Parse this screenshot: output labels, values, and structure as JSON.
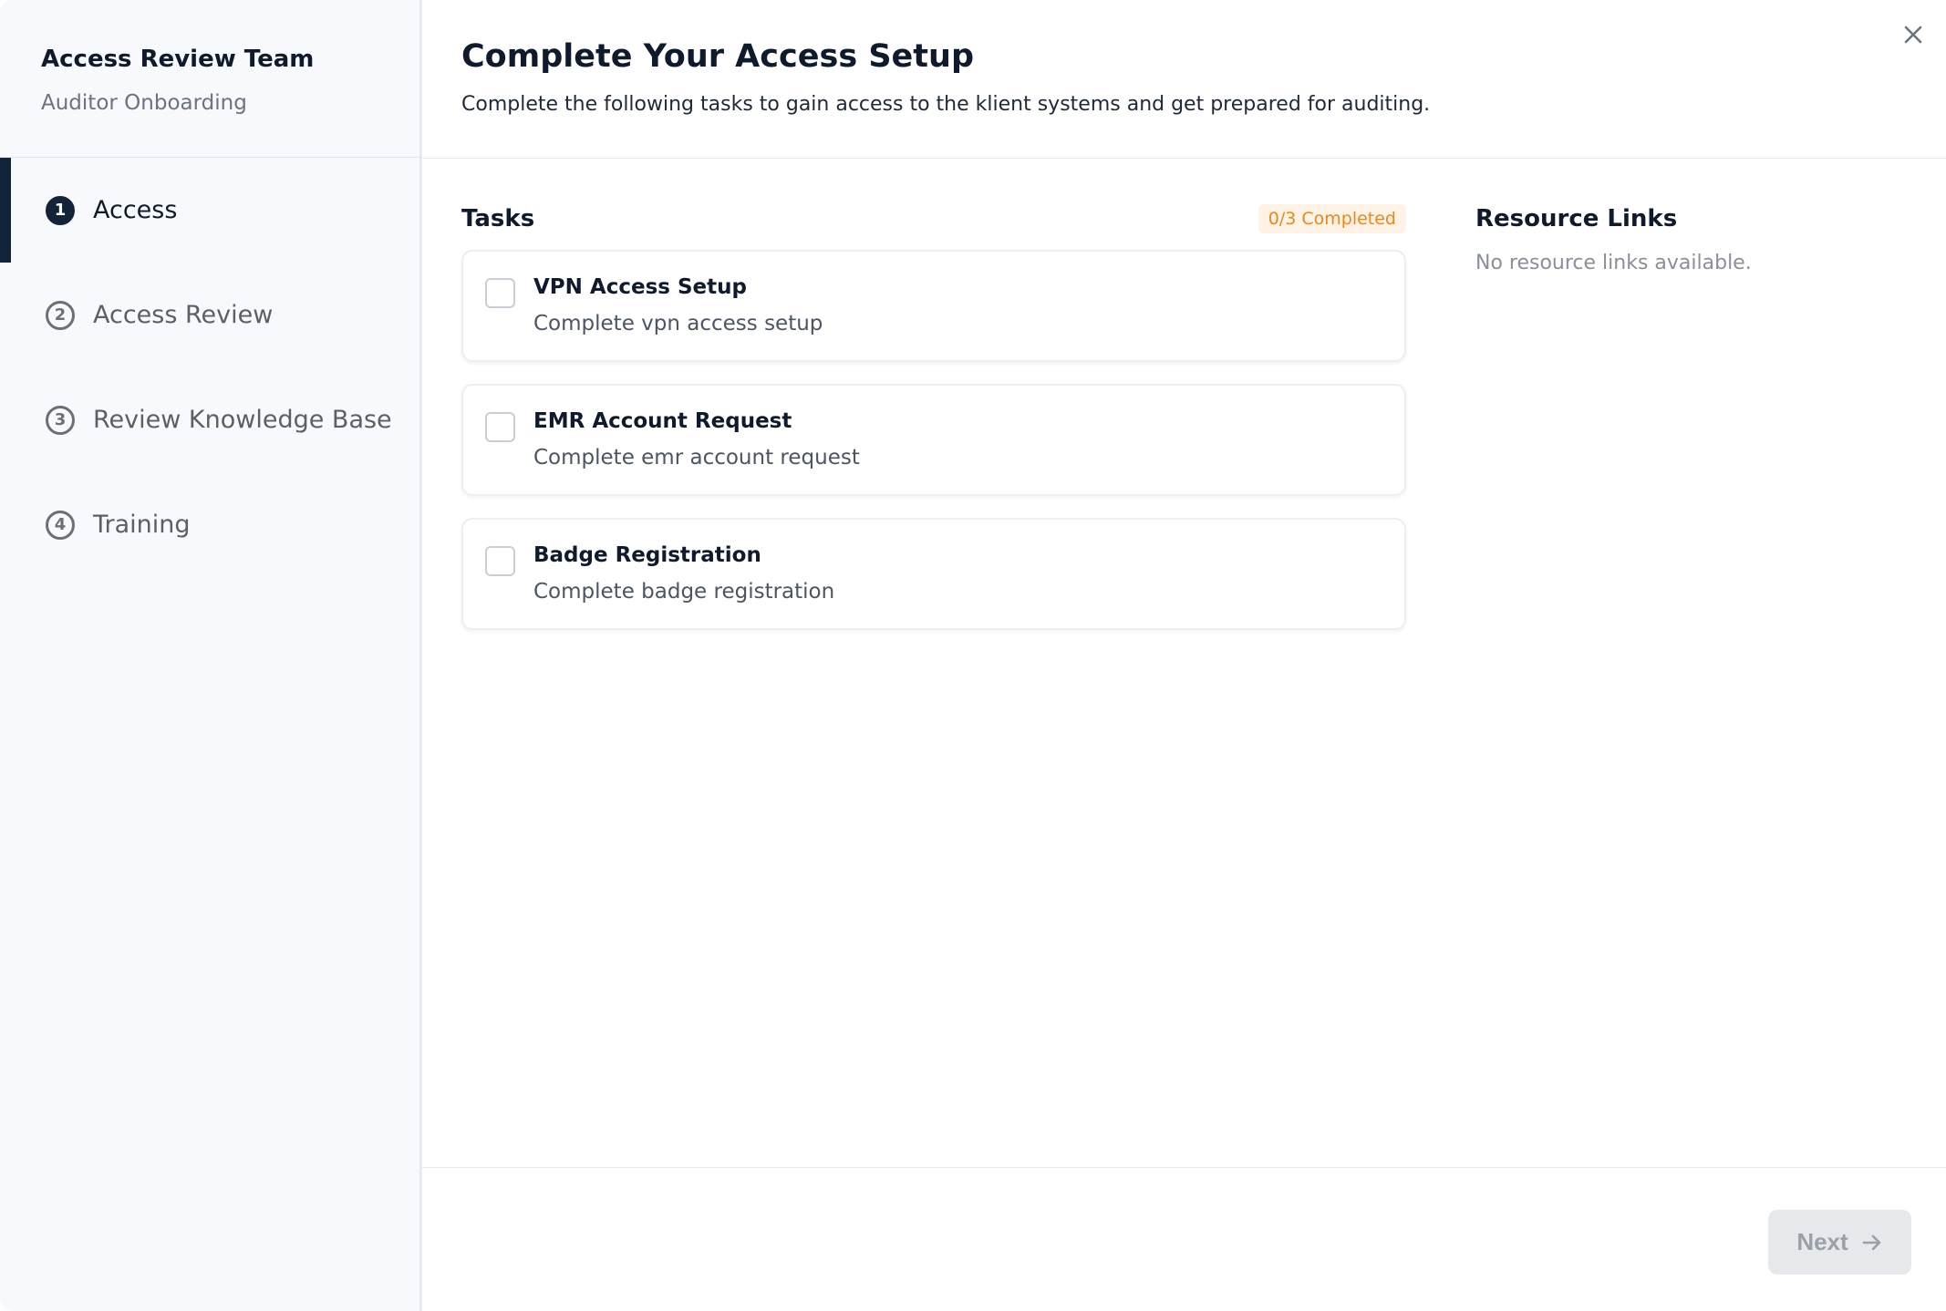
{
  "sidebar": {
    "team_name": "Access Review Team",
    "subtitle": "Auditor Onboarding",
    "steps": [
      {
        "number": "1",
        "label": "Access",
        "active": true
      },
      {
        "number": "2",
        "label": "Access Review",
        "active": false
      },
      {
        "number": "3",
        "label": "Review Knowledge Base",
        "active": false
      },
      {
        "number": "4",
        "label": "Training",
        "active": false
      }
    ]
  },
  "header": {
    "title": "Complete Your Access Setup",
    "description": "Complete the following tasks to gain access to the klient systems and get prepared for auditing.",
    "close_icon": "close-icon"
  },
  "tasks": {
    "title": "Tasks",
    "badge": "0/3 Completed",
    "items": [
      {
        "title": "VPN Access Setup",
        "description": "Complete vpn access setup",
        "checked": false
      },
      {
        "title": "EMR Account Request",
        "description": "Complete emr account request",
        "checked": false
      },
      {
        "title": "Badge Registration",
        "description": "Complete badge registration",
        "checked": false
      }
    ]
  },
  "resources": {
    "title": "Resource Links",
    "empty_text": "No resource links available."
  },
  "footer": {
    "next_label": "Next",
    "next_icon": "arrow-right-icon"
  },
  "colors": {
    "accent": "#13233a",
    "badge_text": "#e8871e",
    "badge_bg": "#fff3e6"
  }
}
